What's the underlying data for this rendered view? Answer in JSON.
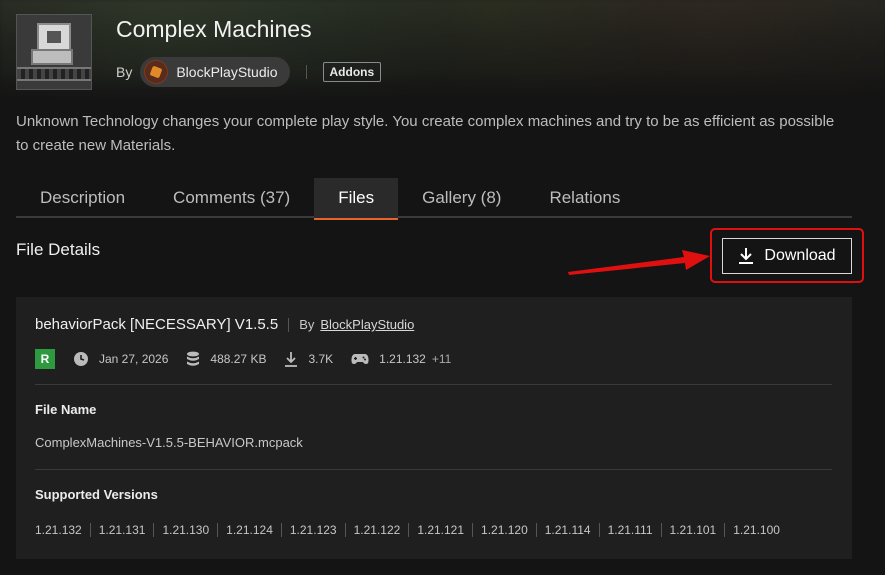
{
  "header": {
    "title": "Complex Machines",
    "by_label": "By",
    "author": "BlockPlayStudio",
    "tag": "Addons"
  },
  "description": "Unknown Technology changes your complete play style. You create complex machines and try to be as efficient as possible to create new Materials.",
  "tabs": [
    {
      "label": "Description",
      "active": false
    },
    {
      "label": "Comments (37)",
      "active": false
    },
    {
      "label": "Files",
      "active": true
    },
    {
      "label": "Gallery (8)",
      "active": false
    },
    {
      "label": "Relations",
      "active": false
    }
  ],
  "section_title": "File Details",
  "download_label": "Download",
  "file": {
    "title": "behaviorPack [NECESSARY] V1.5.5",
    "by_label": "By",
    "author": "BlockPlayStudio",
    "release_badge": "R",
    "date": "Jan 27, 2026",
    "size": "488.27 KB",
    "downloads": "3.7K",
    "game_version": "1.21.132",
    "extra_versions": "+11",
    "file_name_label": "File Name",
    "file_name": "ComplexMachines-V1.5.5-BEHAVIOR.mcpack",
    "supported_label": "Supported Versions",
    "versions": [
      "1.21.132",
      "1.21.131",
      "1.21.130",
      "1.21.124",
      "1.21.123",
      "1.21.122",
      "1.21.121",
      "1.21.120",
      "1.21.114",
      "1.21.111",
      "1.21.101",
      "1.21.100"
    ]
  },
  "colors": {
    "accent": "#e8632a",
    "release_green": "#2e9a40",
    "highlight_red": "#e01010"
  }
}
